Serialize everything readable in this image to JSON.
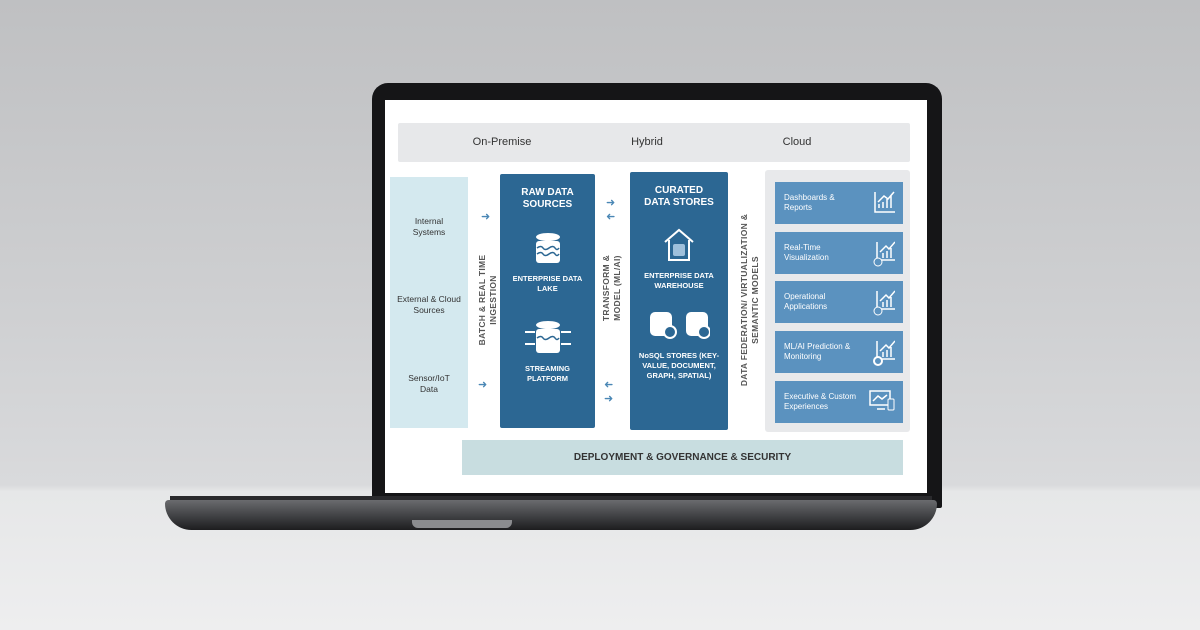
{
  "deployment_tiers": [
    "On-Premise",
    "Hybrid",
    "Cloud"
  ],
  "sources": [
    "Internal Systems",
    "External & Cloud Sources",
    "Sensor/IoT Data"
  ],
  "ingestion_label": "BATCH & REAL TIME INGESTION",
  "raw": {
    "title": "RAW DATA SOURCES",
    "items": [
      "ENTERPRISE DATA LAKE",
      "STREAMING PLATFORM"
    ]
  },
  "transform_label": "TRANSFORM & MODEL (ML/AI)",
  "curated": {
    "title": "CURATED DATA STORES",
    "items": [
      "ENTERPRISE DATA WAREHOUSE",
      "NoSQL STORES (KEY-VALUE, DOCUMENT, GRAPH, SPATIAL)"
    ]
  },
  "federation_label": "DATA FEDERATION/ VIRTUALIZATION & SEMANTIC MODELS",
  "consumers": [
    {
      "label": "Dashboards & Reports",
      "icon": "bar-chart-icon"
    },
    {
      "label": "Real-Time Visualization",
      "icon": "clock-chart-icon"
    },
    {
      "label": "Operational Applications",
      "icon": "question-chart-icon"
    },
    {
      "label": "ML/AI Prediction & Monitoring",
      "icon": "gear-chart-icon"
    },
    {
      "label": "Executive & Custom Experiences",
      "icon": "monitor-icon"
    }
  ],
  "footer": "DEPLOYMENT & GOVERNANCE & SECURITY",
  "colors": {
    "dark_blue": "#2c6793",
    "card_blue": "#5b92bf",
    "light_blue": "#d4e9ef",
    "arrow": "#4a87b5"
  }
}
